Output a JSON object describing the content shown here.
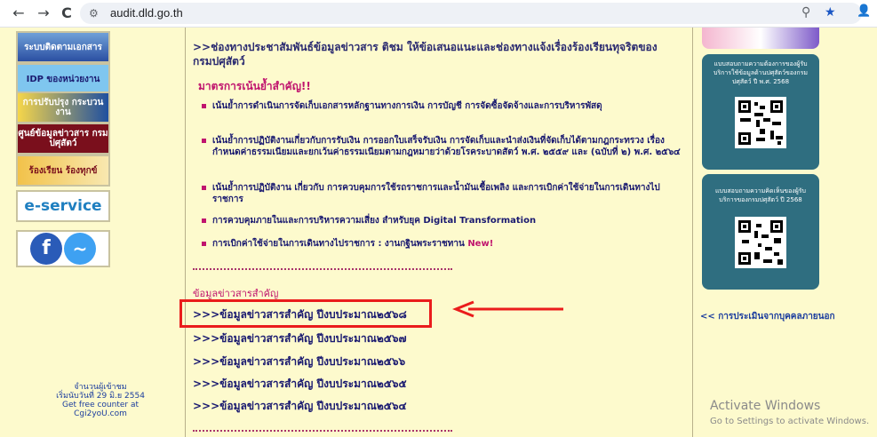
{
  "browser": {
    "url": "audit.dld.go.th",
    "back_glyph": "←",
    "forward_glyph": "→",
    "reload_glyph": "C",
    "zoom_glyph": "⚲",
    "star_glyph": "★",
    "profile_glyph": "👤"
  },
  "left_banners": [
    {
      "label": "ระบบติดตามเอกสาร"
    },
    {
      "label": "IDP ของหน่วยงาน"
    },
    {
      "label": "การปรับปรุง กระบวนงาน"
    },
    {
      "label": "ศูนย์ข้อมูลข่าวสาร กรมปศุสัตว์"
    },
    {
      "label": "ร้องเรียน ร้องทุกข์"
    },
    {
      "label": "e-service"
    },
    {
      "label": "f ~"
    }
  ],
  "counter": {
    "line1": "จำนวนผู้เข้าชม",
    "line2": "เริ่มนับวันที่ 29 มิ.ย 2554",
    "line3": "Get free counter at",
    "line4": "Cgi2yoU.com"
  },
  "main": {
    "heading": ">>ช่องทางประชาสัมพันธ์ข้อมูลข่าวสาร ติชม ให้ข้อเสนอแนะและช่องทางแจ้งเรื่องร้องเรียนทุจริตของกรมปศุสัตว์",
    "section_title": "มาตรการเน้นย้ำสำคัญ!!",
    "bullets": [
      {
        "text": "เน้นย้ำการดำเนินการจัดเก็บเอกสารหลักฐานทางการเงิน การบัญชี การจัดซื้อจัดจ้างและการบริหารพัสดุ"
      },
      {
        "text": "เน้นย้ำการปฏิบัติงานเกี่ยวกับการรับเงิน การออกใบเสร็จรับเงิน การจัดเก็บและนำส่งเงินที่จัดเก็บได้ตามกฎกระทรวง เรื่อง กำหนดค่าธรรมเนียมและยกเว้นค่าธรรมเนียมตามกฎหมายว่าด้วยโรคระบาดสัตว์ พ.ศ. ๒๕๕๙ และ (ฉบับที่ ๒) พ.ศ. ๒๕๖๔"
      },
      {
        "text": "เน้นย้ำการปฏิบัติงาน เกี่ยวกับ การควบคุมการใช้รถราชการและน้ำมันเชื้อเพลิง และการเบิกค่าใช้จ่ายในการเดินทางไปราชการ"
      },
      {
        "text": "การควบคุมภายในและการบริหารความเสี่ยง สำหรับยุค Digital Transformation"
      },
      {
        "text": "การเบิกค่าใช้จ่ายในการเดินทางไปราชการ : งานกฐินพระราชทาน",
        "tag": "New!"
      }
    ],
    "info_title": "ข้อมูลข่าวสารสำคัญ",
    "links": [
      {
        "label": ">>>ข้อมูลข่าวสารสำคัญ ปีงบประมาณ๒๕๖๘"
      },
      {
        "label": ">>>ข้อมูลข่าวสารสำคัญ ปีงบประมาณ๒๕๖๗"
      },
      {
        "label": ">>>ข้อมูลข่าวสารสำคัญ ปีงบประมาณ๒๕๖๖"
      },
      {
        "label": ">>>ข้อมูลข่าวสารสำคัญ ปีงบประมาณ๒๕๖๕"
      },
      {
        "label": ">>>ข้อมูลข่าวสารสำคัญ ปีงบประมาณ๒๕๖๔"
      }
    ]
  },
  "right": {
    "qr_cards": [
      {
        "text": "แบบสอบถามความต้องการของผู้รับบริการใช้ข้อมูลด้านปศุสัตว์ของกรมปศุสัตว์ ปี พ.ศ. 2568"
      },
      {
        "text": "แบบสอบถามความคิดเห็นของผู้รับบริการของกรมปศุสัตว์ ปี 2568"
      }
    ],
    "eval_link": "<< การประเมินจากบุคคลภายนอก"
  },
  "watermark": {
    "line1": "Activate Windows",
    "line2": "Go to Settings to activate Windows."
  },
  "colors": {
    "page_bg": "#fdfacd",
    "accent_pink": "#c0146e",
    "link_navy": "#1a1a70",
    "highlight_red": "#ea1c1c",
    "qr_card_teal": "#2f6e80"
  }
}
